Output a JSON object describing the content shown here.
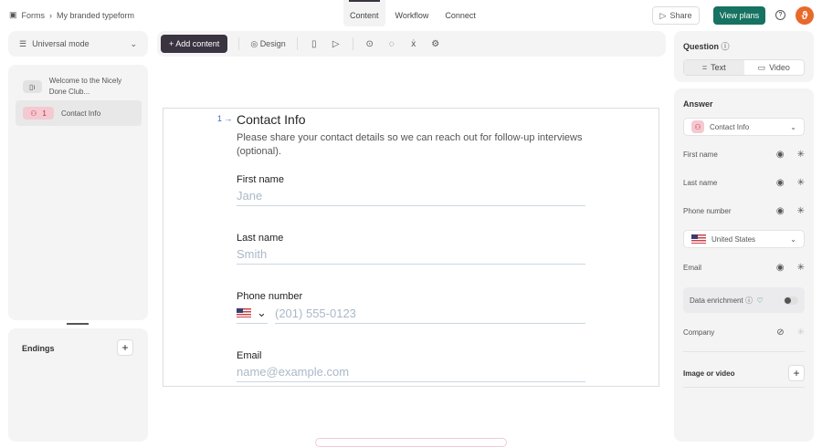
{
  "header": {
    "breadcrumb": [
      "Forms",
      "My branded typeform"
    ],
    "tabs": [
      "Content",
      "Workflow",
      "Connect"
    ],
    "share": "Share",
    "view_plans": "View plans",
    "help": "?"
  },
  "left": {
    "mode": "Universal mode",
    "items": [
      {
        "label": "Welcome to the Nicely Done Club...",
        "num": ""
      },
      {
        "label": "Contact Info",
        "num": "1"
      }
    ],
    "endings": "Endings"
  },
  "toolbar": {
    "add_content": "Add content",
    "design": "Design"
  },
  "question": {
    "number": "1",
    "title": "Contact Info",
    "description": "Please share your contact details so we can reach out for follow-up interviews (optional).",
    "fields": [
      {
        "label": "First name",
        "placeholder": "Jane"
      },
      {
        "label": "Last name",
        "placeholder": "Smith"
      },
      {
        "label": "Phone number",
        "placeholder": "(201) 555-0123"
      },
      {
        "label": "Email",
        "placeholder": "name@example.com"
      }
    ]
  },
  "right": {
    "question_label": "Question",
    "text": "Text",
    "video": "Video",
    "answer_label": "Answer",
    "answer_type": "Contact Info",
    "fields": [
      "First name",
      "Last name",
      "Phone number"
    ],
    "country": "United States",
    "email": "Email",
    "enrichment": "Data enrichment",
    "enrichment_on": false,
    "company": "Company",
    "image_video": "Image or video"
  }
}
